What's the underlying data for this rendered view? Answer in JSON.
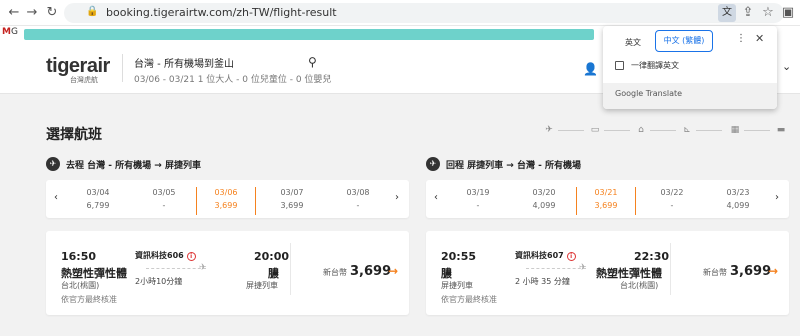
{
  "browser": {
    "url": "booking.tigerairtw.com/zh-TW/flight-result",
    "gmail_label": "M",
    "gmail_text": "G",
    "translate_chip": "文"
  },
  "translate_popup": {
    "tab_english": "英文",
    "tab_chinese": "中文 (繁體)",
    "always_translate": "一律翻譯英文",
    "brand": "Google Translate"
  },
  "header": {
    "logo": "tigerair",
    "logo_sub": "台灣虎航",
    "route_title": "台灣 - 所有機場到釜山",
    "route_sub": "03/06 - 03/21   1 位大人 - 0 位兒童位 - 0 位嬰兒"
  },
  "main": {
    "page_title": "選擇航班"
  },
  "outbound": {
    "heading": "去程  台灣 - 所有機場 → 屏捷列車",
    "dates": [
      {
        "date": "03/04",
        "price": "6,799"
      },
      {
        "date": "03/05",
        "price": "-"
      },
      {
        "date": "03/06",
        "price": "3,699"
      },
      {
        "date": "03/07",
        "price": "3,699"
      },
      {
        "date": "03/08",
        "price": "-"
      }
    ],
    "flight": {
      "dep_time": "16:50",
      "dep_city": "熱塑性彈性體",
      "dep_sub": "台北(桃園)",
      "flight_no": "資訊科技606",
      "duration": "2小時10分鐘",
      "arr_time": "20:00",
      "arr_city": "膿",
      "arr_sub": "屏捷列車",
      "currency": "新台幣",
      "price": "3,699",
      "note": "依官方最終核准"
    }
  },
  "inbound": {
    "heading": "回程  屏捷列車 → 台灣 - 所有機場",
    "dates": [
      {
        "date": "03/19",
        "price": "-"
      },
      {
        "date": "03/20",
        "price": "4,099"
      },
      {
        "date": "03/21",
        "price": "3,699"
      },
      {
        "date": "03/22",
        "price": "-"
      },
      {
        "date": "03/23",
        "price": "4,099"
      }
    ],
    "flight": {
      "dep_time": "20:55",
      "dep_city": "膿",
      "dep_sub": "屏捷列車",
      "flight_no": "資訊科技607",
      "duration": "2 小時 35 分鐘",
      "arr_time": "22:30",
      "arr_city": "熱塑性彈性體",
      "arr_sub": "台北(桃園)",
      "currency": "新台幣",
      "price": "3,699",
      "note": "依官方最終核准"
    }
  },
  "colors": {
    "accent": "#f5821f",
    "redaction": "#6ed2cb",
    "translate_blue": "#1a73e8"
  }
}
